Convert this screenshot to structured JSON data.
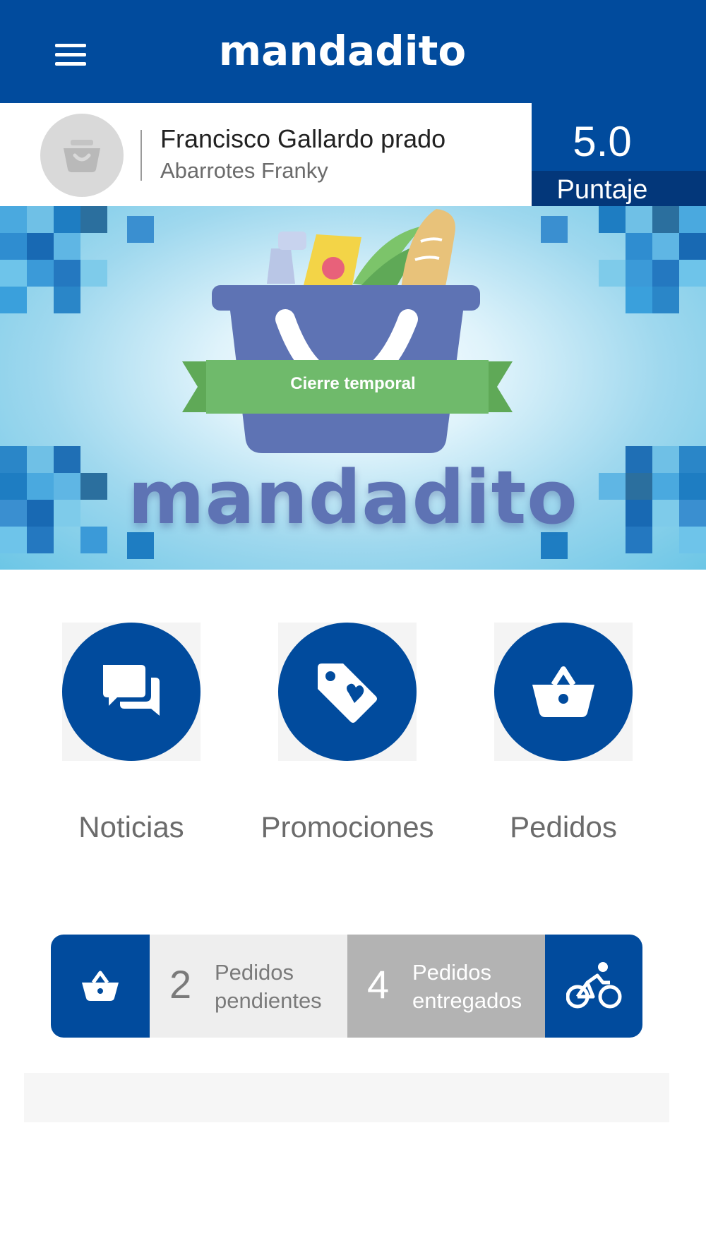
{
  "header": {
    "title": "mandadito",
    "menu_icon": "hamburger-menu-icon",
    "bg_color": "#014b9d"
  },
  "user": {
    "name": "Francisco Gallardo prado",
    "store": "Abarrotes Franky",
    "avatar_icon": "basket-icon",
    "score_value": "5.0",
    "score_label": "Puntaje"
  },
  "banner": {
    "ribbon_text": "Cierre temporal",
    "brand_text": "mandadito"
  },
  "features": [
    {
      "label": "Noticias",
      "icon": "chat-bubbles-icon"
    },
    {
      "label": "Promociones",
      "icon": "heart-tag-icon"
    },
    {
      "label": "Pedidos",
      "icon": "basket-icon"
    }
  ],
  "stats": {
    "basket_icon": "basket-icon",
    "pending_count": "2",
    "pending_label_1": "Pedidos",
    "pending_label_2": "pendientes",
    "delivered_count": "4",
    "delivered_label_1": "Pedidos",
    "delivered_label_2": "entregados",
    "bike_icon": "bicycle-rider-icon"
  },
  "colors": {
    "primary": "#014b9d",
    "ribbon": "#6fba6b",
    "basket": "#5e73b4"
  }
}
